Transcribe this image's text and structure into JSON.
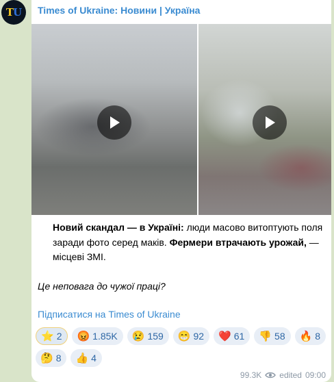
{
  "channel": {
    "name": "Times of Ukraine: Новини | Україна",
    "avatar_letter_1": "T",
    "avatar_letter_2": "U",
    "avatar_color_1": "#f3c623",
    "avatar_color_2": "#2f6fd6"
  },
  "media": {
    "videos": [
      {
        "type": "video",
        "play_icon": "play-icon"
      },
      {
        "type": "video",
        "play_icon": "play-icon"
      }
    ]
  },
  "post": {
    "line1_bold": "Новий скандал — в Україні:",
    "line1_rest": " люди масово витоптують поля заради фото серед маків. ",
    "line2_bold": "Фермери втрачають урожай,",
    "line2_rest": " — місцеві ЗМІ.",
    "question": "Це неповага до чужої праці?",
    "subscribe_link": "Підписатися на Times of Ukraine"
  },
  "reactions": [
    {
      "emoji": "⭐",
      "icon": "star-icon",
      "count": "2"
    },
    {
      "emoji": "😡",
      "icon": "angry-face-icon",
      "count": "1.85K"
    },
    {
      "emoji": "😢",
      "icon": "crying-face-icon",
      "count": "159"
    },
    {
      "emoji": "😁",
      "icon": "grinning-face-icon",
      "count": "92"
    },
    {
      "emoji": "❤️",
      "icon": "heart-icon",
      "count": "61"
    },
    {
      "emoji": "👎",
      "icon": "thumbs-down-icon",
      "count": "58"
    },
    {
      "emoji": "🔥",
      "icon": "fire-icon",
      "count": "8"
    },
    {
      "emoji": "🤔",
      "icon": "thinking-face-icon",
      "count": "8"
    },
    {
      "emoji": "👍",
      "icon": "thumbs-up-icon",
      "count": "4"
    }
  ],
  "footer": {
    "views": "99.3K",
    "edited": "edited",
    "time": "09:00"
  },
  "colors": {
    "link": "#3a8bd1",
    "reaction_text": "#2e67a5",
    "background": "#d9e4c9"
  }
}
